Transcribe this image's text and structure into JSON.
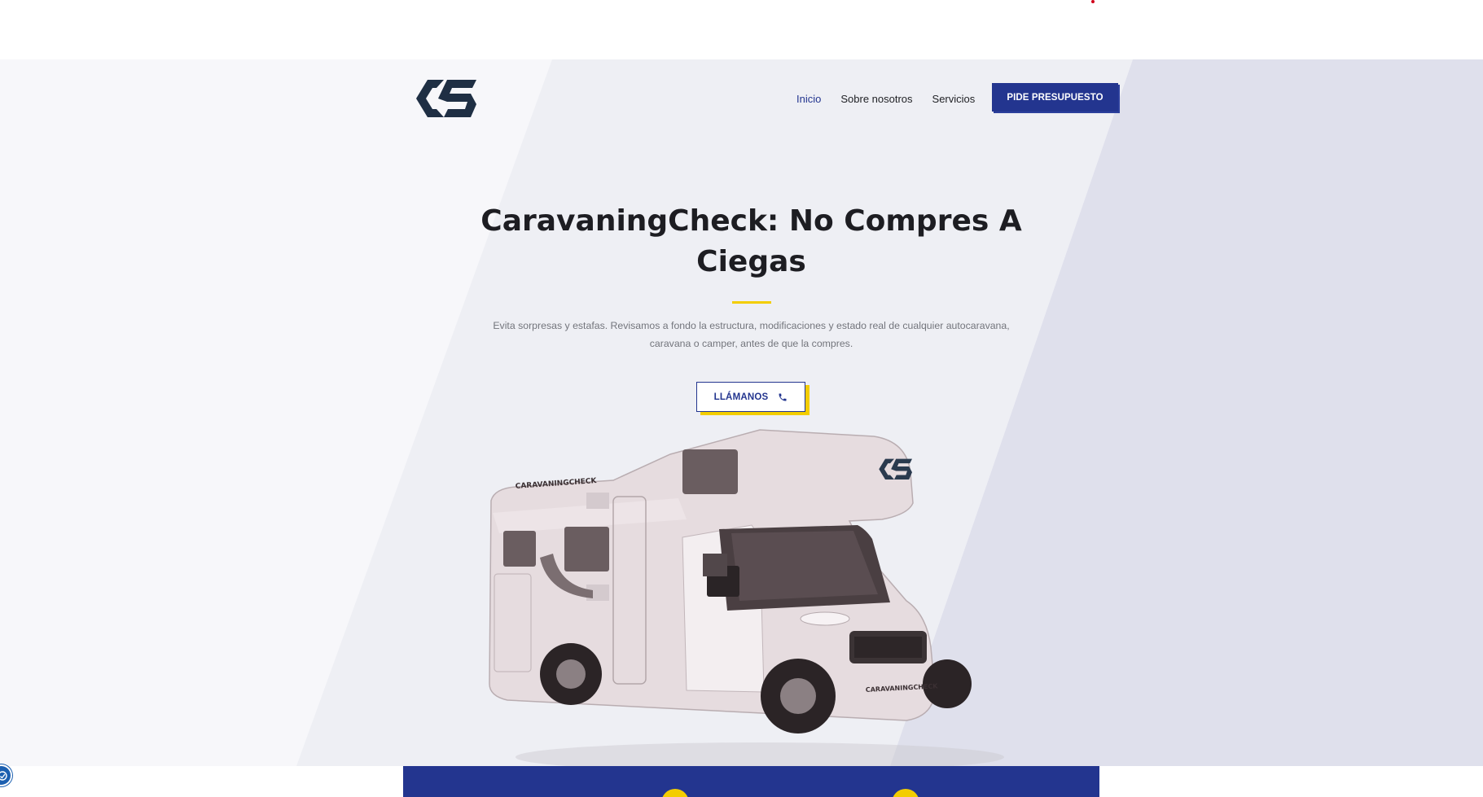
{
  "header": {
    "logo_name": "caravaningcheck-logo",
    "nav": [
      {
        "label": "Inicio",
        "active": true
      },
      {
        "label": "Sobre nosotros",
        "active": false
      },
      {
        "label": "Servicios",
        "active": false
      }
    ],
    "cta_label": "PIDE PRESUPUESTO"
  },
  "hero": {
    "title": "CaravaningCheck: No Compres A Ciegas",
    "subtitle": "Evita sorpresas y estafas. Revisamos a fondo la estructura, modificaciones y estado real de cualquier autocaravana, caravana o camper, antes de que la compres.",
    "call_label": "LLÁMANOS",
    "call_icon": "phone-icon",
    "camper_brand_side": "CARAVANINGCHECK",
    "camper_brand_front": "CARAVANINGCHECK"
  },
  "colors": {
    "brand_blue": "#23358f",
    "accent_yellow": "#f3cd00",
    "logo_navy": "#1f2f44",
    "text_dark": "#1d1d22",
    "text_muted": "#73757c"
  },
  "widgets": {
    "accessibility_icon": "accessibility-icon"
  }
}
